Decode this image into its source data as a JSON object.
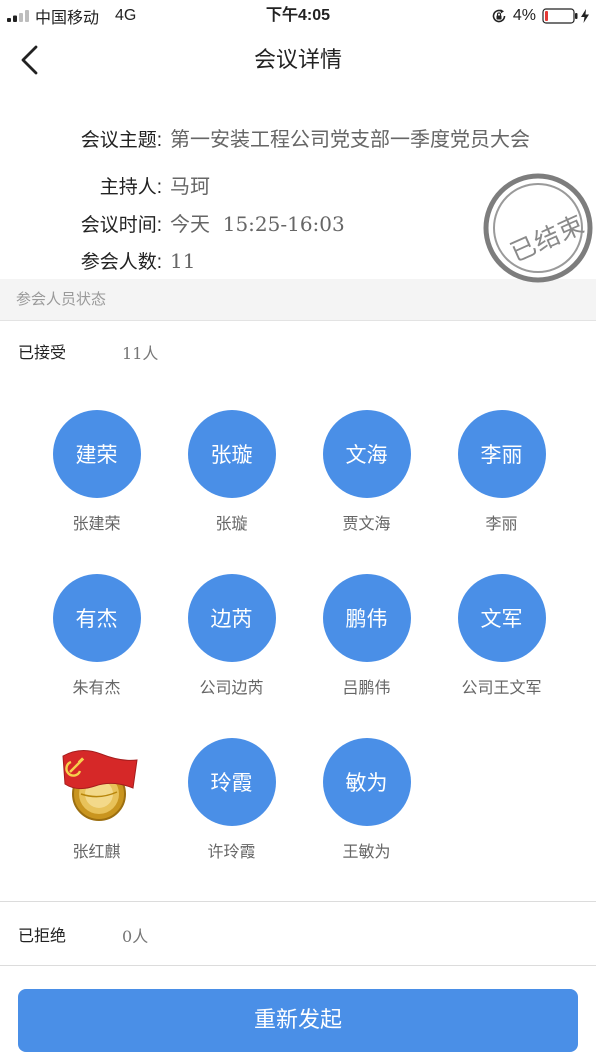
{
  "status_bar": {
    "carrier": "中国移动",
    "network": "4G",
    "time": "下午4:05",
    "battery_percent": "4%",
    "battery_level": 0.04,
    "icons": [
      "signal-icon",
      "orientation-lock-icon",
      "battery-icon",
      "charging-bolt-icon"
    ]
  },
  "nav": {
    "title": "会议详情",
    "back_icon": "chevron-left-icon"
  },
  "meeting": {
    "topic": {
      "label": "会议主题:",
      "value": "第一安装工程公司党支部一季度党员大会"
    },
    "host": {
      "label": "主持人:",
      "value": "马珂"
    },
    "time": {
      "label": "会议时间:",
      "value": "今天  15:25-16:03"
    },
    "attendees": {
      "label": "参会人数:",
      "value": "11"
    }
  },
  "stamp": {
    "text": "已结束"
  },
  "attendance_section": {
    "title": "参会人员状态"
  },
  "accepted": {
    "label": "已接受",
    "count": "11人",
    "members": [
      {
        "avatar": "建荣",
        "name": "张建荣"
      },
      {
        "avatar": "张璇",
        "name": "张璇"
      },
      {
        "avatar": "文海",
        "name": "贾文海"
      },
      {
        "avatar": "李丽",
        "name": "李丽"
      },
      {
        "avatar": "有杰",
        "name": "朱有杰"
      },
      {
        "avatar": "边芮",
        "name": "公司边芮"
      },
      {
        "avatar": "鹏伟",
        "name": "吕鹏伟"
      },
      {
        "avatar": "文军",
        "name": "公司王文军"
      },
      {
        "avatar_icon": "party-badge-icon",
        "name": "张红麒"
      },
      {
        "avatar": "玲霞",
        "name": "许玲霞"
      },
      {
        "avatar": "敏为",
        "name": "王敏为"
      }
    ]
  },
  "rejected": {
    "label": "已拒绝",
    "count": "0人"
  },
  "action": {
    "label": "重新发起"
  },
  "colors": {
    "accent": "#4a8fe7",
    "section_bg": "#f4f4f4",
    "stamp": "#8a8a8a",
    "battery_low": "#e53935"
  }
}
